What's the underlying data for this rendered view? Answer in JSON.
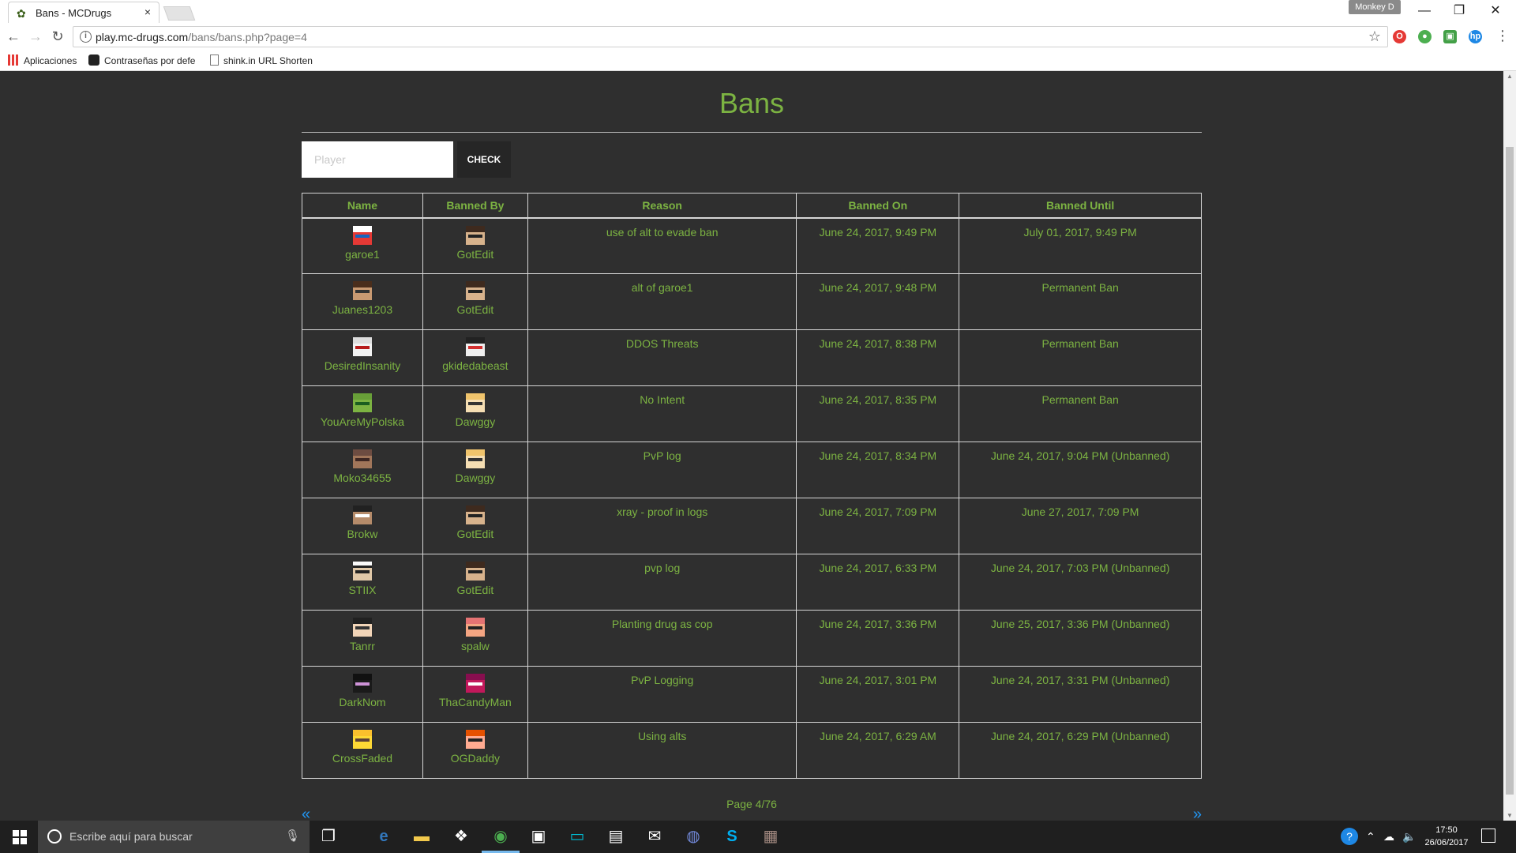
{
  "browser": {
    "tab_title": "Bans - MCDrugs",
    "tab_close": "×",
    "profile_name": "Monkey D",
    "url_host": "play.mc-drugs.com",
    "url_path": "/bans/bans.php?page=4",
    "bookmarks": [
      {
        "label": "Aplicaciones",
        "icon": "apps-grid-icon"
      },
      {
        "label": "Contraseñas por defe",
        "icon": "steam-icon"
      },
      {
        "label": "shink.in URL Shorten",
        "icon": "page-icon"
      }
    ]
  },
  "page": {
    "title": "Bans",
    "search": {
      "placeholder": "Player",
      "button_label": "CHECK"
    },
    "columns": [
      "Name",
      "Banned By",
      "Reason",
      "Banned On",
      "Banned Until"
    ],
    "rows": [
      {
        "name": "garoe1",
        "banned_by": "GotEdit",
        "reason": "use of alt to evade ban",
        "banned_on": "June 24, 2017, 9:49 PM",
        "banned_until": "July 01, 2017, 9:49 PM"
      },
      {
        "name": "Juanes1203",
        "banned_by": "GotEdit",
        "reason": "alt of garoe1",
        "banned_on": "June 24, 2017, 9:48 PM",
        "banned_until": "Permanent Ban"
      },
      {
        "name": "DesiredInsanity",
        "banned_by": "gkidedabeast",
        "reason": "DDOS Threats",
        "banned_on": "June 24, 2017, 8:38 PM",
        "banned_until": "Permanent Ban"
      },
      {
        "name": "YouAreMyPolska",
        "banned_by": "Dawggy",
        "reason": "No Intent",
        "banned_on": "June 24, 2017, 8:35 PM",
        "banned_until": "Permanent Ban"
      },
      {
        "name": "Moko34655",
        "banned_by": "Dawggy",
        "reason": "PvP log",
        "banned_on": "June 24, 2017, 8:34 PM",
        "banned_until": "June 24, 2017, 9:04 PM (Unbanned)"
      },
      {
        "name": "Brokw",
        "banned_by": "GotEdit",
        "reason": "xray - proof in logs",
        "banned_on": "June 24, 2017, 7:09 PM",
        "banned_until": "June 27, 2017, 7:09 PM"
      },
      {
        "name": "STIIX",
        "banned_by": "GotEdit",
        "reason": "pvp log",
        "banned_on": "June 24, 2017, 6:33 PM",
        "banned_until": "June 24, 2017, 7:03 PM (Unbanned)"
      },
      {
        "name": "Tanrr",
        "banned_by": "spalw",
        "reason": "Planting drug as cop",
        "banned_on": "June 24, 2017, 3:36 PM",
        "banned_until": "June 25, 2017, 3:36 PM (Unbanned)"
      },
      {
        "name": "DarkNom",
        "banned_by": "ThaCandyMan",
        "reason": "PvP Logging",
        "banned_on": "June 24, 2017, 3:01 PM",
        "banned_until": "June 24, 2017, 3:31 PM (Unbanned)"
      },
      {
        "name": "CrossFaded",
        "banned_by": "OGDaddy",
        "reason": "Using alts",
        "banned_on": "June 24, 2017, 6:29 AM",
        "banned_until": "June 24, 2017, 6:29 PM (Unbanned)"
      }
    ],
    "pagination": {
      "prev": "«",
      "info": "Page 4/76",
      "next": "»"
    }
  },
  "taskbar": {
    "search_placeholder": "Escribe aquí para buscar",
    "time": "17:50",
    "date": "26/06/2017"
  },
  "colors": {
    "accent_green": "#7cb342",
    "page_bg": "#2f2f2f",
    "link_blue": "#2196f3"
  }
}
